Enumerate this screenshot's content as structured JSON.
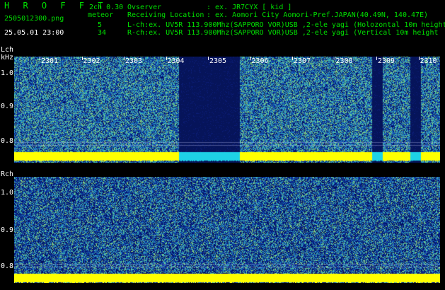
{
  "app": {
    "title": "H R O F F T",
    "version": "2ch 0.30",
    "filename": "2505012300.png",
    "mode_label": "meteor",
    "datetime": "25.05.01 23:00",
    "lch_count": "5",
    "rch_count": "34"
  },
  "info": {
    "observer_label": "Ovserver",
    "observer_value": ": ex. JR7CYX [ kid ]",
    "location_label": "Receiving Location",
    "location_value": ": ex. Aomori City Aomori-Pref.JAPAN(40.49N, 140.47E)",
    "lch_line": "L-ch:ex. UV5R 113.900Mhz(SAPPORO VOR)USB ,2-ele yagi (Holozontal 10m height",
    "rch_line": "R-ch:ex. UV5R 113.900Mhz(SAPPORO VOR)USB ,2-ele yagi (Vertical 10m height"
  },
  "lch": {
    "name": "Lch",
    "unit": "kHz",
    "y_ticks": [
      "1.0",
      "0.9",
      "0.8"
    ],
    "time_labels": [
      "2301",
      "2302",
      "2303",
      "2304",
      "2305",
      "2306",
      "2307",
      "2308",
      "2309",
      "2310"
    ],
    "gaps_minutes": [
      [
        3.95,
        5.4
      ],
      [
        8.55,
        8.8
      ],
      [
        9.45,
        9.7
      ]
    ]
  },
  "rch": {
    "name": "Rch",
    "y_ticks": [
      "1.0",
      "0.9",
      "0.8"
    ]
  },
  "colors": {
    "background": "#000000",
    "header_text": "#00e000",
    "label_text": "#ffffff",
    "noise_band": "#ffff00",
    "gap": "#06145a"
  }
}
